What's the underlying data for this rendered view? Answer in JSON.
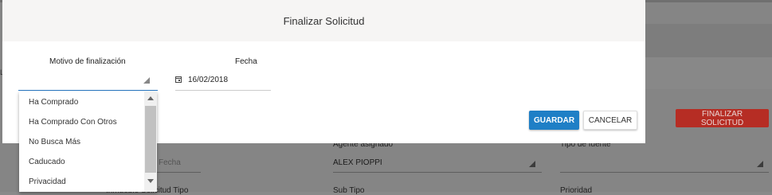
{
  "modal": {
    "title": "Finalizar Solicitud",
    "motivo_label": "Motivo de finalización",
    "fecha_label": "Fecha",
    "fecha_value": "16/02/2018",
    "guardar_label": "GUARDAR",
    "cancelar_label": "CANCELAR"
  },
  "dropdown": {
    "options": [
      "Ha Comprado",
      "Ha Comprado Con Otros",
      "No Busca Más",
      "Caducado",
      "Privacidad"
    ]
  },
  "background": {
    "finalizar_button": "FINALIZAR SOLICITUD",
    "fecha_placeholder": "Fecha",
    "agente_label": "Agente asignado",
    "agente_value": "ALEX PIOPPI",
    "tipo_fuente_label": "Tipo de fuente",
    "inmueble_label": "Inmueble Solicitud Tipo",
    "subtipo_label": "Sub Tipo",
    "prioridad_label": "Prioridad",
    "left_char": "L"
  },
  "colors": {
    "primary": "#1f7fc6",
    "danger": "#b62d24",
    "overlay": "#858585"
  }
}
